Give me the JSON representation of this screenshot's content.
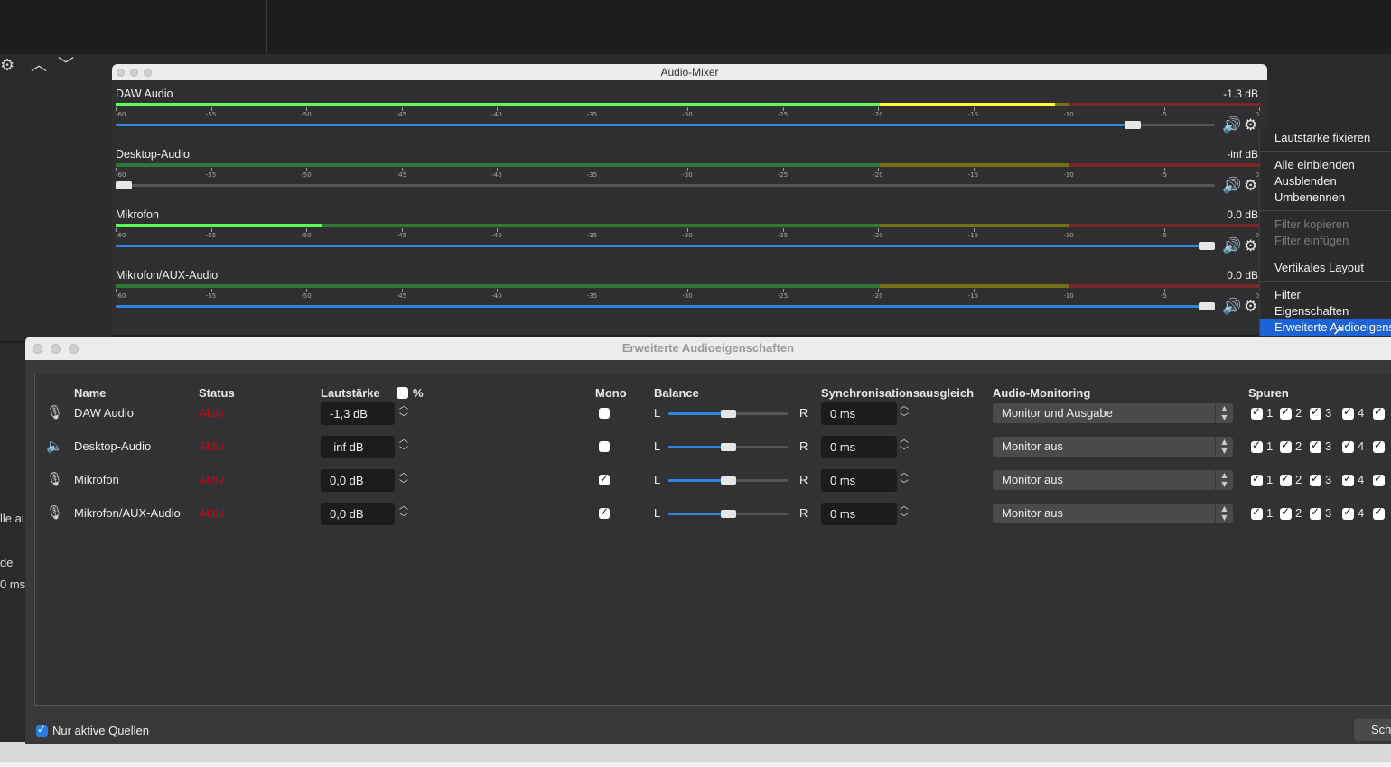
{
  "mixer": {
    "title": "Audio-Mixer",
    "tick_labels": [
      "-60",
      "-55",
      "-50",
      "-45",
      "-40",
      "-35",
      "-30",
      "-25",
      "-20",
      "-15",
      "-10",
      "-5",
      "0"
    ],
    "channels": [
      {
        "name": "DAW Audio",
        "db": "-1.3 dB",
        "level_fraction": 0.82,
        "volume_fraction": 0.925
      },
      {
        "name": "Desktop-Audio",
        "db": "-inf dB",
        "level_fraction": 0.0,
        "volume_fraction": 0.0
      },
      {
        "name": "Mikrofon",
        "db": "0.0 dB",
        "level_fraction": 0.18,
        "volume_fraction": 1.0
      },
      {
        "name": "Mikrofon/AUX-Audio",
        "db": "0.0 dB",
        "level_fraction": 0.0,
        "volume_fraction": 1.0
      }
    ],
    "colors": {
      "green": "#35d335",
      "yellow": "#c9c200",
      "red": "#d32020",
      "blue": "#2e86de"
    }
  },
  "context_menu": {
    "items": [
      {
        "label": "Lautstärke fixieren",
        "enabled": true
      },
      {
        "label": "Alle einblenden",
        "enabled": true
      },
      {
        "label": "Ausblenden",
        "enabled": true
      },
      {
        "label": "Umbenennen",
        "enabled": true
      },
      {
        "label": "Filter kopieren",
        "enabled": false
      },
      {
        "label": "Filter einfügen",
        "enabled": false
      },
      {
        "label": "Vertikales Layout",
        "enabled": true
      },
      {
        "label": "Filter",
        "enabled": true
      },
      {
        "label": "Eigenschaften",
        "enabled": true
      },
      {
        "label": "Erweiterte Audioeigenschaften",
        "enabled": true,
        "selected": true
      }
    ]
  },
  "advanced": {
    "title": "Erweiterte Audioeigenschaften",
    "headers": {
      "name": "Name",
      "status": "Status",
      "volume": "Lautstärke",
      "percent": "%",
      "mono": "Mono",
      "balance": "Balance",
      "sync": "Synchronisationsausgleich",
      "monitoring": "Audio-Monitoring",
      "tracks": "Spuren"
    },
    "balance_l": "L",
    "balance_r": "R",
    "track_numbers": [
      "1",
      "2",
      "3",
      "4"
    ],
    "rows": [
      {
        "icon": "microphone-icon",
        "name": "DAW Audio",
        "status": "Aktiv",
        "volume": "-1,3 dB",
        "mono": false,
        "balance_fraction": 0.5,
        "sync": "0 ms",
        "monitoring": "Monitor und Ausgabe"
      },
      {
        "icon": "speaker-icon",
        "name": "Desktop-Audio",
        "status": "Aktiv",
        "volume": "-inf dB",
        "mono": false,
        "balance_fraction": 0.5,
        "sync": "0 ms",
        "monitoring": "Monitor aus"
      },
      {
        "icon": "microphone-icon",
        "name": "Mikrofon",
        "status": "Aktiv",
        "volume": "0,0 dB",
        "mono": true,
        "balance_fraction": 0.5,
        "sync": "0 ms",
        "monitoring": "Monitor aus"
      },
      {
        "icon": "microphone-icon",
        "name": "Mikrofon/AUX-Audio",
        "status": "Aktiv",
        "volume": "0,0 dB",
        "mono": true,
        "balance_fraction": 0.5,
        "sync": "0 ms",
        "monitoring": "Monitor aus"
      }
    ],
    "only_active_label": "Nur aktive Quellen",
    "close_label": "Sch"
  },
  "background": {
    "fragments": [
      "lle au",
      "de",
      "0 ms"
    ]
  }
}
